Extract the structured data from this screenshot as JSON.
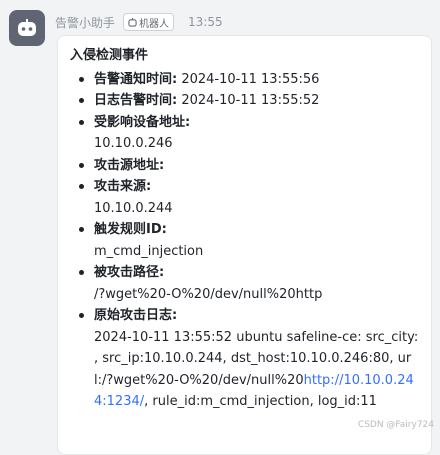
{
  "message": {
    "sender": "告警小助手",
    "badge": "机器人",
    "time": "13:55",
    "title": "入侵检测事件",
    "fields": [
      {
        "label": "告警通知时间:",
        "value": "2024-10-11 13:55:56"
      },
      {
        "label": "日志告警时间:",
        "value": "2024-10-11 13:55:52"
      },
      {
        "label": "受影响设备地址:",
        "value": "10.10.0.246"
      },
      {
        "label": "攻击源地址:",
        "value": ""
      },
      {
        "label": "攻击来源:",
        "value": "10.10.0.244"
      },
      {
        "label": "触发规则ID:",
        "value": "m_cmd_injection"
      },
      {
        "label": "被攻击路径:",
        "value": "/?wget%20-O%20/dev/null%20http"
      }
    ],
    "raw_log": {
      "label": "原始攻击日志:",
      "text_before": "2024-10-11 13:55:52 ubuntu safeline-ce: src_city: , src_ip:10.10.0.244, dst_host:10.10.0.246:80, url:/?wget%20-O%20/dev/null%20",
      "link": "http://10.10.0.244:1234/",
      "text_after": ", rule_id:m_cmd_injection, log_id:11"
    }
  },
  "watermark": "CSDN @Fairy724"
}
